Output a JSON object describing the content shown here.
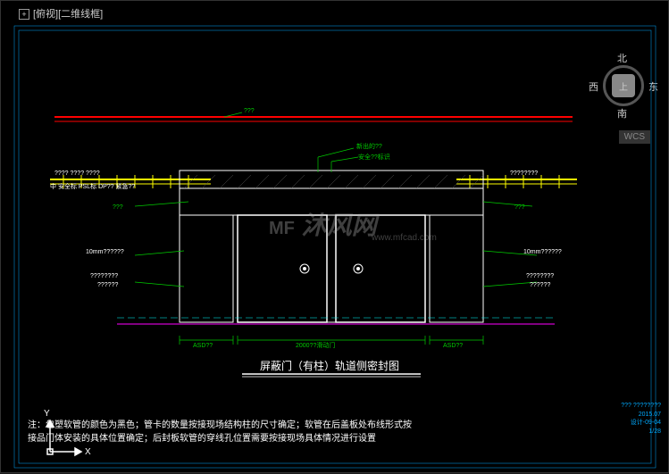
{
  "panel": {
    "label": "[俯视][二维线框]",
    "plus": "+"
  },
  "compass": {
    "n": "北",
    "s": "南",
    "e": "东",
    "w": "西",
    "center": "上"
  },
  "wcs": "WCS",
  "drawing_title": "屏蔽门（有柱）轨道侧密封图",
  "watermark": {
    "main": "沐风网",
    "sub": "www.mfcad.com",
    "logo": "MF"
  },
  "note": {
    "prefix": "注：",
    "line1": "包塑软管的颜色为黑色；管卡的数量按接现场结构柱的尺寸确定；软管在后盖板处布线形式按",
    "line2": "接品门体安装的具体位置确定；后封板软管的穿线孔位置需要按接现场具体情况进行设置"
  },
  "labels": {
    "left_top1": "???? ???? ????",
    "left_top2": "中 安全标 PSL标 DP?? 紧急??",
    "left_mid1": "???",
    "left_10mm": "10mm??????",
    "left_bot": "????????",
    "left_bot2": "??????",
    "right_top": "????????",
    "right_mid": "???",
    "right_10mm": "10mm??????",
    "right_bot": "????????",
    "right_bot2": "??????",
    "center_top1": "新出的??",
    "center_top2": "安全??标识",
    "dim_left": "ASD??",
    "dim_center": "2000??滑动门",
    "dim_right": "ASD??",
    "red_label": "???"
  },
  "titleblock": {
    "l1": "???  ????????",
    "l2": "2015.07",
    "l3": "设计-09-04",
    "l4": "1/28"
  },
  "chart_data": {
    "type": "diagram",
    "description": "CAD elevation drawing of platform screen doors (屏蔽门) with column, track side sealing view",
    "elements": [
      "sliding door panels (2x)",
      "side panels (ASD)",
      "overhead beam",
      "cable conduit (软管)",
      "10mm panels",
      "safety signs",
      "structural columns"
    ],
    "dimensions": {
      "sliding_door_width": 2000,
      "unit": "mm (implied)"
    },
    "colors": {
      "structure": "#fff",
      "conduit": "#ff0",
      "beam": "#f00",
      "ground": "#f0f",
      "leaders": "#0c0",
      "title": "#0af"
    }
  }
}
